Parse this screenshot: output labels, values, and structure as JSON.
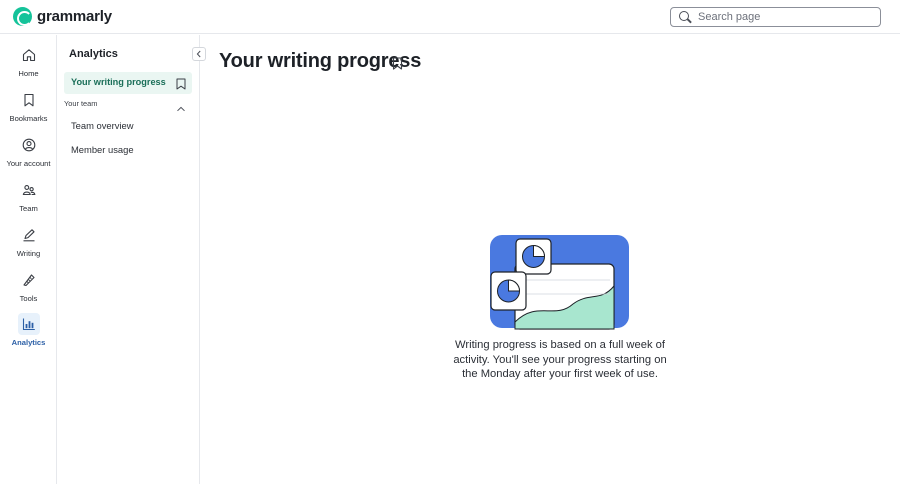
{
  "app": {
    "brand": "grammarly",
    "brand_color": "#15c39a",
    "accent_color": "#2b5fa6"
  },
  "search": {
    "placeholder": "Search page",
    "value": ""
  },
  "rail": {
    "items": [
      {
        "label": "Home",
        "icon": "home-icon",
        "active": false
      },
      {
        "label": "Bookmarks",
        "icon": "bookmark-icon",
        "active": false
      },
      {
        "label": "Your account",
        "icon": "account-icon",
        "active": false
      },
      {
        "label": "Team",
        "icon": "team-icon",
        "active": false
      },
      {
        "label": "Writing",
        "icon": "pen-icon",
        "active": false
      },
      {
        "label": "Tools",
        "icon": "tools-icon",
        "active": false
      },
      {
        "label": "Analytics",
        "icon": "analytics-icon",
        "active": true
      }
    ]
  },
  "sidebar": {
    "title": "Analytics",
    "active_item": "Your writing progress",
    "group": "Your team",
    "items": [
      "Team overview",
      "Member usage"
    ]
  },
  "main": {
    "title": "Your writing progress",
    "empty_state": {
      "illustration": "writing-progress-illustration",
      "message": "Writing progress is based on a full week of activity. You'll see your progress starting on the Monday after your first week of use."
    }
  }
}
